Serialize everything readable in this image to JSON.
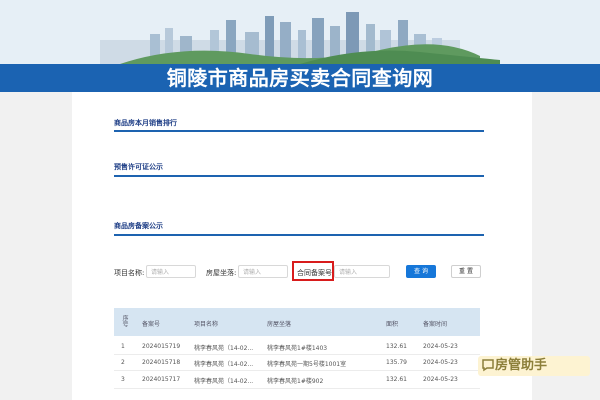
{
  "header": {
    "title": "铜陵市商品房买卖合同查询网"
  },
  "sections": {
    "ranking": "商品房本月销售排行",
    "presale": "预售许可证公示",
    "filing": "商品房备案公示"
  },
  "search": {
    "project_label": "项目名称:",
    "project_placeholder": "请输入",
    "location_label": "房屋坐落:",
    "location_placeholder": "请输入",
    "contract_label": "合同备案号",
    "contract_placeholder": "请输入",
    "query_button": "查 询",
    "reset_button": "重 置"
  },
  "table": {
    "headers": [
      "序号",
      "备案号",
      "项目名称",
      "房屋坐落",
      "面积",
      "备案时间"
    ],
    "rows": [
      [
        "1",
        "2024015719",
        "桃李春风苑（14-02...",
        "桃李春风苑1#楼1403",
        "132.61",
        "2024-05-23"
      ],
      [
        "2",
        "2024015718",
        "桃李春风苑（14-02...",
        "桃李春风苑一期5号楼1001室",
        "135.79",
        "2024-05-23"
      ],
      [
        "3",
        "2024015717",
        "桃李春风苑（14-02...",
        "桃李春风苑1#楼902",
        "132.61",
        "2024-05-23"
      ]
    ]
  },
  "watermark": {
    "text": "房管助手",
    "icon": "chat-icon"
  },
  "colors": {
    "accent": "#1b63b2",
    "button": "#1677d9",
    "highlight": "#d81c1c"
  }
}
